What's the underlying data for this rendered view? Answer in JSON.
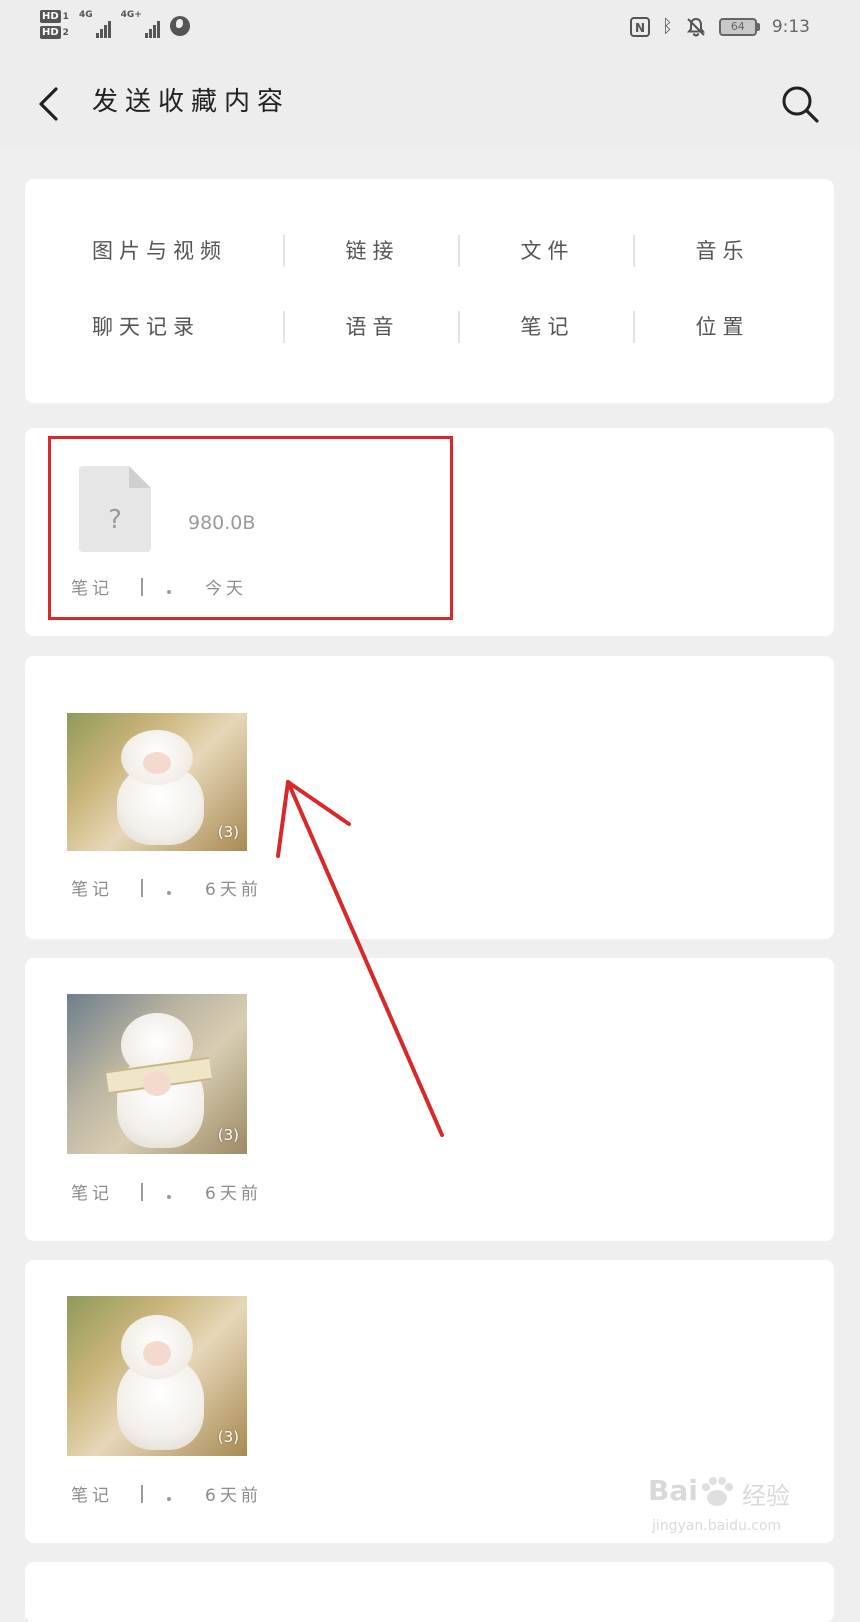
{
  "status_bar": {
    "hd_label": "HD",
    "sim1_net": "4G",
    "sim2_net": "4G+",
    "battery": "64",
    "time": "9:13"
  },
  "nav": {
    "title": "发送收藏内容"
  },
  "categories": {
    "row1": [
      "图片与视频",
      "链接",
      "文件",
      "音乐"
    ],
    "row2": [
      "聊天记录",
      "语音",
      "笔记",
      "位置"
    ]
  },
  "items": [
    {
      "kind": "file",
      "file_icon_glyph": "?",
      "size": "980.0B",
      "type": "笔记",
      "time": "今天"
    },
    {
      "kind": "photo",
      "count": "(3)",
      "type": "笔记",
      "time": "6天前"
    },
    {
      "kind": "photo",
      "count": "(3)",
      "type": "笔记",
      "time": "6天前"
    },
    {
      "kind": "photo",
      "count": "(3)",
      "type": "笔记",
      "time": "6天前"
    }
  ],
  "watermark": {
    "brand": "Bai",
    "brand_suffix": "经验",
    "url": "jingyan.baidu.com"
  },
  "colors": {
    "background": "#efefef",
    "card": "#ffffff",
    "annotation": "#d8282a"
  }
}
